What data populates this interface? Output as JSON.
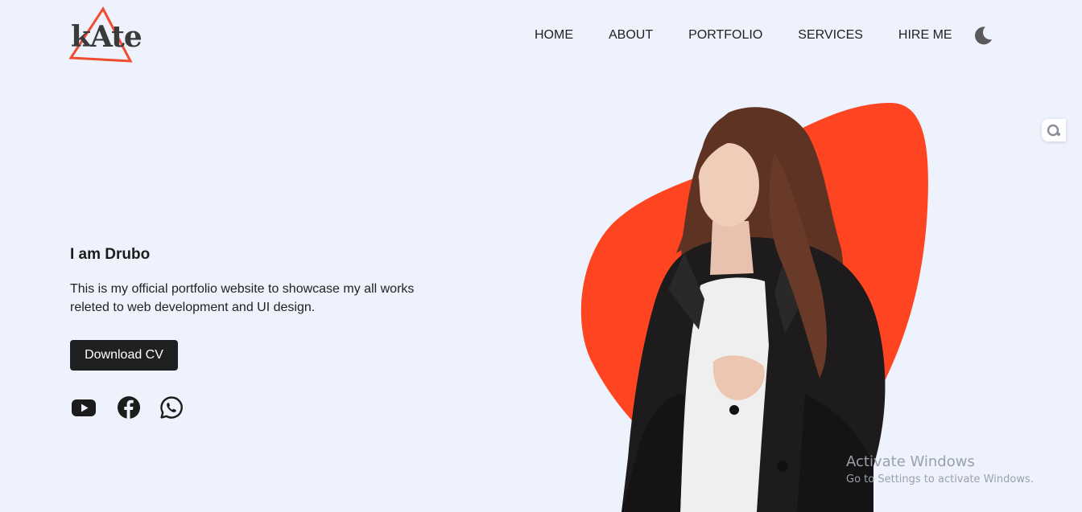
{
  "brand": {
    "logo_text": "kAte",
    "accent_color": "#f24b2f"
  },
  "nav": {
    "items": [
      {
        "label": "HOME"
      },
      {
        "label": "ABOUT"
      },
      {
        "label": "PORTFOLIO"
      },
      {
        "label": "SERVICES"
      },
      {
        "label": "HIRE ME"
      }
    ],
    "theme_toggle_icon": "moon-icon"
  },
  "hero": {
    "title": "I am Drubo",
    "description": "This is my official portfolio website to showcase my all works releted to web development and UI design.",
    "cta_label": "Download CV",
    "blob_color": "#ff4422"
  },
  "social": {
    "icons": [
      "youtube-icon",
      "facebook-icon",
      "whatsapp-icon"
    ]
  },
  "os_watermark": {
    "line1": "Activate Windows",
    "line2": "Go to Settings to activate Windows."
  }
}
